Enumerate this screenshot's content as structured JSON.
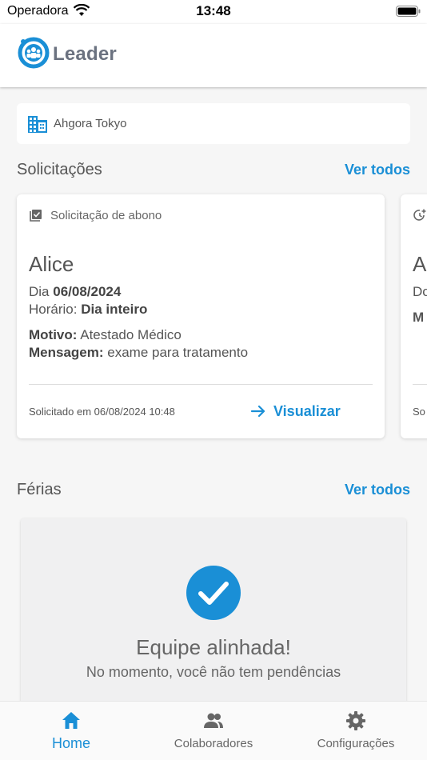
{
  "status_bar": {
    "carrier": "Operadora",
    "time": "13:48"
  },
  "app": {
    "brand": "Leader"
  },
  "company": {
    "name": "Ahgora Tokyo"
  },
  "requests": {
    "title": "Solicitações",
    "see_all": "Ver todos",
    "cards": [
      {
        "type": "Solicitação de abono",
        "name": "Alice",
        "day_label": "Dia",
        "day": "06/08/2024",
        "time_label": "Horário:",
        "time": "Dia inteiro",
        "reason_label": "Motivo:",
        "reason": "Atestado Médico",
        "message_label": "Mensagem:",
        "message": "exame para tratamento",
        "requested_at": "Solicitado em 06/08/2024 10:48",
        "view_label": "Visualizar"
      },
      {
        "name_initial": "A",
        "line1": "Do",
        "line2": "M",
        "footer": "So"
      }
    ]
  },
  "vacations": {
    "title": "Férias",
    "see_all": "Ver todos",
    "empty_title": "Equipe alinhada!",
    "empty_subtitle": "No momento, você não tem pendências"
  },
  "tabs": [
    {
      "label": "Home",
      "icon": "home-icon",
      "active": true
    },
    {
      "label": "Colaboradores",
      "icon": "people-icon",
      "active": false
    },
    {
      "label": "Configurações",
      "icon": "gear-icon",
      "active": false
    }
  ],
  "colors": {
    "accent": "#1a8fd6",
    "text": "#555555",
    "background": "#f6f6f6"
  }
}
